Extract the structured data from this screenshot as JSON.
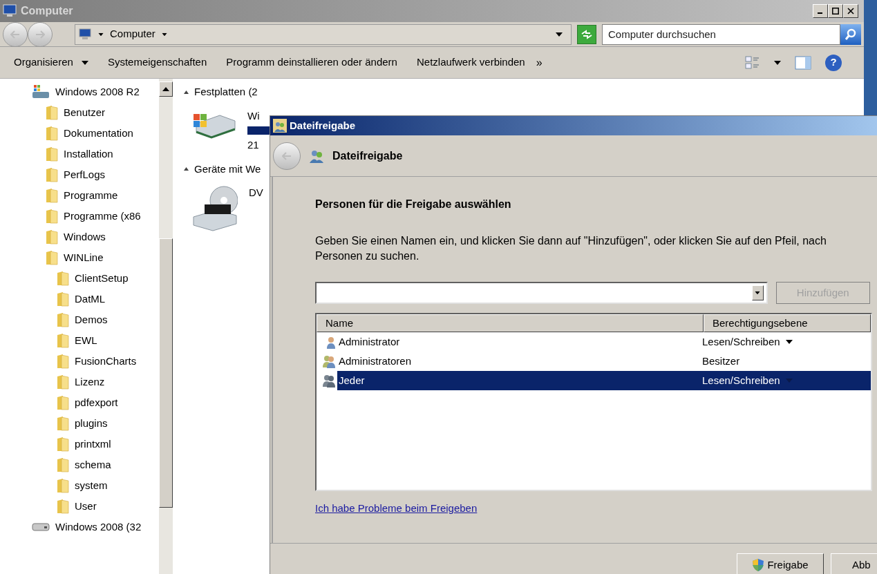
{
  "explorer": {
    "title": "Computer",
    "address": {
      "segments": [
        "Computer"
      ]
    },
    "search": {
      "placeholder": "Computer durchsuchen"
    },
    "toolbar": [
      {
        "label": "Organisieren",
        "dropdown": true
      },
      {
        "label": "Systemeigenschaften",
        "dropdown": false
      },
      {
        "label": "Programm deinstallieren oder ändern",
        "dropdown": false
      },
      {
        "label": "Netzlaufwerk verbinden",
        "dropdown": false
      }
    ],
    "toolbar_overflow": "»",
    "help": "?",
    "tree": [
      {
        "label": "Windows 2008 R2",
        "kind": "system_drive",
        "children": [
          {
            "label": "Benutzer",
            "kind": "folder"
          },
          {
            "label": "Dokumentation",
            "kind": "folder"
          },
          {
            "label": "Installation",
            "kind": "folder"
          },
          {
            "label": "PerfLogs",
            "kind": "folder"
          },
          {
            "label": "Programme",
            "kind": "folder"
          },
          {
            "label": "Programme (x86",
            "kind": "folder"
          },
          {
            "label": "Windows",
            "kind": "folder"
          },
          {
            "label": "WINLine",
            "kind": "folder",
            "children": [
              {
                "label": "ClientSetup",
                "kind": "folder"
              },
              {
                "label": "DatML",
                "kind": "folder"
              },
              {
                "label": "Demos",
                "kind": "folder"
              },
              {
                "label": "EWL",
                "kind": "folder"
              },
              {
                "label": "FusionCharts",
                "kind": "folder"
              },
              {
                "label": "Lizenz",
                "kind": "folder"
              },
              {
                "label": "pdfexport",
                "kind": "folder"
              },
              {
                "label": "plugins",
                "kind": "folder"
              },
              {
                "label": "printxml",
                "kind": "folder"
              },
              {
                "label": "schema",
                "kind": "folder"
              },
              {
                "label": "system",
                "kind": "folder"
              },
              {
                "label": "User",
                "kind": "folder"
              }
            ]
          }
        ]
      },
      {
        "label": "Windows 2008 (32",
        "kind": "drive"
      }
    ],
    "groups": [
      {
        "label": "Festplatten (2",
        "items": [
          {
            "kind": "hdd",
            "name": "Wi",
            "detail": "21"
          }
        ]
      },
      {
        "label": "Geräte mit We",
        "items": [
          {
            "kind": "dvd",
            "name": "DV"
          }
        ]
      }
    ]
  },
  "dialog": {
    "title": "Dateifreigabe",
    "header": "Dateifreigabe",
    "heading": "Personen für die Freigabe auswählen",
    "description": "Geben Sie einen Namen ein, und klicken Sie dann auf \"Hinzufügen\", oder klicken Sie auf den Pfeil, nach Personen zu suchen.",
    "add_button": {
      "label": "Hinzufügen",
      "disabled": true
    },
    "table": {
      "columns": [
        "Name",
        "Berechtigungsebene"
      ],
      "rows": [
        {
          "name": "Administrator",
          "kind": "user",
          "permission": "Lesen/Schreiben",
          "dropdown": true,
          "selected": false
        },
        {
          "name": "Administratoren",
          "kind": "group",
          "permission": "Besitzer",
          "dropdown": false,
          "selected": false
        },
        {
          "name": "Jeder",
          "kind": "group",
          "permission": "Lesen/Schreiben",
          "dropdown": true,
          "selected": true
        }
      ]
    },
    "link": "Ich habe Probleme beim Freigeben",
    "buttons": [
      {
        "label": "Freigabe",
        "shield": true
      },
      {
        "label": "Abb",
        "shield": false
      }
    ]
  }
}
